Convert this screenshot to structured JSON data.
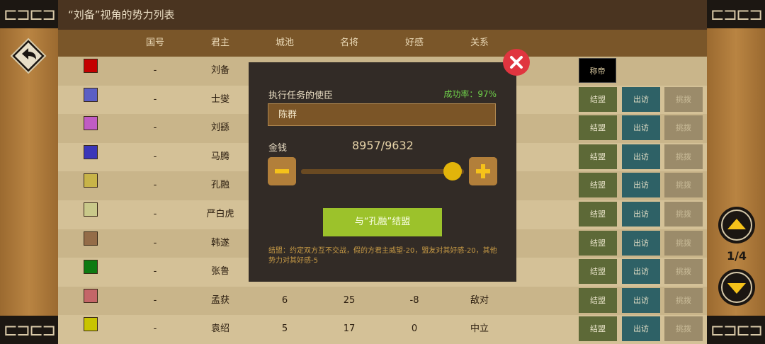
{
  "title": "“刘备”视角的势力列表",
  "columns": [
    "国号",
    "君主",
    "城池",
    "名将",
    "好感",
    "关系"
  ],
  "rows": [
    {
      "color": "#c40000",
      "state": "-",
      "lord": "刘备",
      "cities": "",
      "generals": "",
      "favor": "",
      "relation": "",
      "is_self": true
    },
    {
      "color": "#5b5fc4",
      "state": "-",
      "lord": "士燮",
      "cities": "",
      "generals": "",
      "favor": "",
      "relation": ""
    },
    {
      "color": "#c05cc4",
      "state": "-",
      "lord": "刘繇",
      "cities": "",
      "generals": "",
      "favor": "",
      "relation": ""
    },
    {
      "color": "#3a36b8",
      "state": "-",
      "lord": "马腾",
      "cities": "",
      "generals": "",
      "favor": "",
      "relation": ""
    },
    {
      "color": "#c8b448",
      "state": "-",
      "lord": "孔融",
      "cities": "",
      "generals": "",
      "favor": "",
      "relation": ""
    },
    {
      "color": "#c9c98a",
      "state": "-",
      "lord": "严白虎",
      "cities": "",
      "generals": "",
      "favor": "",
      "relation": ""
    },
    {
      "color": "#946c48",
      "state": "-",
      "lord": "韩遂",
      "cities": "",
      "generals": "",
      "favor": "",
      "relation": ""
    },
    {
      "color": "#0e7a12",
      "state": "-",
      "lord": "张鲁",
      "cities": "",
      "generals": "",
      "favor": "",
      "relation": ""
    },
    {
      "color": "#c46668",
      "state": "-",
      "lord": "孟获",
      "cities": "6",
      "generals": "25",
      "favor": "-8",
      "relation": "敌对"
    },
    {
      "color": "#c8c400",
      "state": "-",
      "lord": "袁绍",
      "cities": "5",
      "generals": "17",
      "favor": "0",
      "relation": "中立"
    }
  ],
  "buttons": {
    "emperor": "称帝",
    "ally": "结盟",
    "visit": "出访",
    "provoke": "挑拨"
  },
  "modal": {
    "envoy_label": "执行任务的使臣",
    "success_rate": "成功率：97%",
    "envoy_name": "陈群",
    "money_label": "金钱",
    "money_value": "8957/9632",
    "money_fraction": 0.93,
    "action_label": "与“孔融”结盟",
    "description": "结盟：约定双方互不交战，假的方君主威望-20，盟友对其好感-20，其他势力对其好感-5"
  },
  "pager": {
    "label": "1/4"
  },
  "icons": {
    "back": "back-arrow-icon",
    "close": "close-icon",
    "up": "arrow-up-icon",
    "down": "arrow-down-icon",
    "minus": "minus-icon",
    "plus": "plus-icon"
  }
}
